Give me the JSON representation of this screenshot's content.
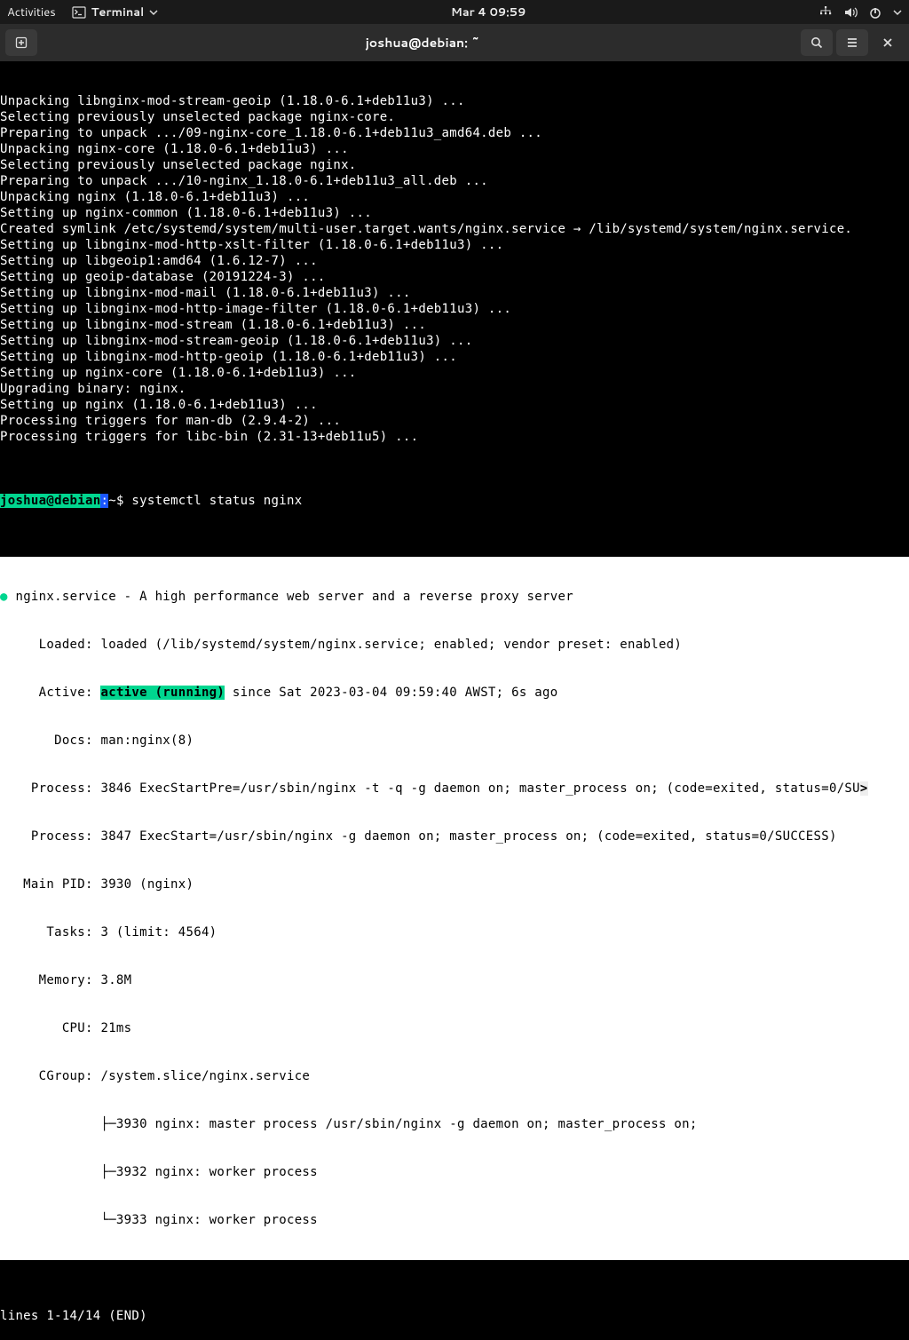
{
  "topbar": {
    "activities": "Activities",
    "terminal": "Terminal",
    "datetime": "Mar 4  09:59"
  },
  "titlebar": {
    "title": "joshua@debian: ~"
  },
  "terminal_top": {
    "lines": [
      "Unpacking libnginx-mod-stream-geoip (1.18.0-6.1+deb11u3) ...",
      "Selecting previously unselected package nginx-core.",
      "Preparing to unpack .../09-nginx-core_1.18.0-6.1+deb11u3_amd64.deb ...",
      "Unpacking nginx-core (1.18.0-6.1+deb11u3) ...",
      "Selecting previously unselected package nginx.",
      "Preparing to unpack .../10-nginx_1.18.0-6.1+deb11u3_all.deb ...",
      "Unpacking nginx (1.18.0-6.1+deb11u3) ...",
      "Setting up nginx-common (1.18.0-6.1+deb11u3) ...",
      "Created symlink /etc/systemd/system/multi-user.target.wants/nginx.service → /lib/systemd/system/nginx.service.",
      "Setting up libnginx-mod-http-xslt-filter (1.18.0-6.1+deb11u3) ...",
      "Setting up libgeoip1:amd64 (1.6.12-7) ...",
      "Setting up geoip-database (20191224-3) ...",
      "Setting up libnginx-mod-mail (1.18.0-6.1+deb11u3) ...",
      "Setting up libnginx-mod-http-image-filter (1.18.0-6.1+deb11u3) ...",
      "Setting up libnginx-mod-stream (1.18.0-6.1+deb11u3) ...",
      "Setting up libnginx-mod-stream-geoip (1.18.0-6.1+deb11u3) ...",
      "Setting up libnginx-mod-http-geoip (1.18.0-6.1+deb11u3) ...",
      "Setting up nginx-core (1.18.0-6.1+deb11u3) ...",
      "Upgrading binary: nginx.",
      "Setting up nginx (1.18.0-6.1+deb11u3) ...",
      "Processing triggers for man-db (2.9.4-2) ...",
      "Processing triggers for libc-bin (2.31-13+deb11u5) ..."
    ]
  },
  "prompt": {
    "user": "joshua@debian",
    "colon": ":",
    "path": "~",
    "dollar": "$ ",
    "command": "systemctl status nginx"
  },
  "status": {
    "bullet": "●",
    "title": " nginx.service - A high performance web server and a reverse proxy server",
    "loaded": "     Loaded: loaded (/lib/systemd/system/nginx.service; enabled; vendor preset: enabled)",
    "active_pre": "     Active: ",
    "active_hl": "active (running)",
    "active_post": " since Sat 2023-03-04 09:59:40 AWST; 6s ago",
    "docs": "       Docs: man:nginx(8)",
    "process1_pre": "    Process: 3846 ExecStartPre=/usr/sbin/nginx -t -q -g daemon on; master_process on; (code=exited, status=0/SU",
    "process1_ovf": ">",
    "process2": "    Process: 3847 ExecStart=/usr/sbin/nginx -g daemon on; master_process on; (code=exited, status=0/SUCCESS)",
    "mainpid": "   Main PID: 3930 (nginx)",
    "tasks": "      Tasks: 3 (limit: 4564)",
    "memory": "     Memory: 3.8M",
    "cpu": "        CPU: 21ms",
    "cgroup": "     CGroup: /system.slice/nginx.service",
    "cgroup1": "             ├─3930 nginx: master process /usr/sbin/nginx -g daemon on; master_process on;",
    "cgroup2": "             ├─3932 nginx: worker process",
    "cgroup3": "             └─3933 nginx: worker process"
  },
  "pager": "lines 1-14/14 (END)"
}
